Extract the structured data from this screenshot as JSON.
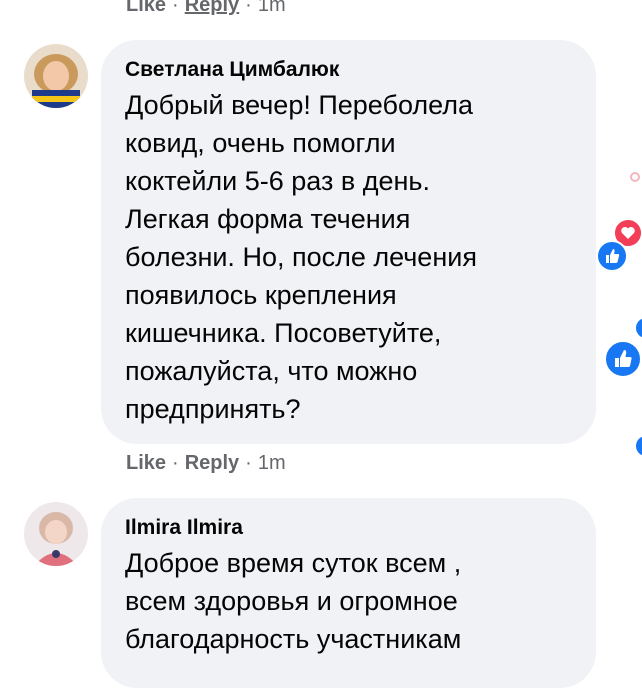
{
  "comments": [
    {
      "author": "",
      "text_lines": [],
      "actions": {
        "like": "Like",
        "reply": "Reply",
        "time": "1m"
      }
    },
    {
      "author": "Светлана Цимбалюк",
      "text_lines": [
        "Добрый вечер! Переболела",
        "ковид, очень помогли",
        "коктейли 5-6 раз в день.",
        "Легкая форма течения",
        "болезни. Но, после лечения",
        "появилось крепления",
        "кишечника. Посоветуйте,",
        "пожалуйста, что можно",
        "предпринять?"
      ],
      "actions": {
        "like": "Like",
        "reply": "Reply",
        "time": "1m"
      }
    },
    {
      "author": "Ilmira Ilmira",
      "text_lines": [
        "Доброе время суток всем ,",
        "всем здоровья и огромное",
        "благодарность участникам"
      ]
    }
  ],
  "separator": "·",
  "colors": {
    "bubble": "#f0f2f5",
    "meta_text": "#65676b",
    "like_blue": "#1877f2",
    "love_red": "#f33e58"
  },
  "icons": [
    "like-icon",
    "love-icon"
  ]
}
